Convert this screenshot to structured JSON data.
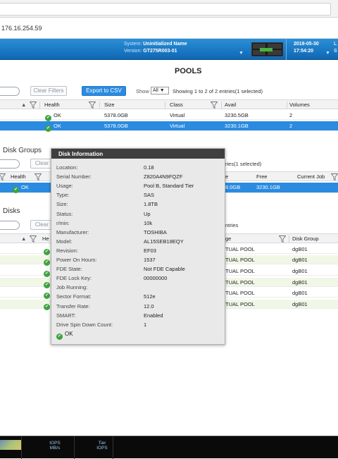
{
  "browser": {
    "url": "176.16.254.59"
  },
  "header": {
    "system_label": "System:",
    "system_name": "Uninitialized Name",
    "version_label": "Version:",
    "version_value": "GT275R003-01",
    "date": "2019-05-30",
    "time": "17:54:20",
    "edge_top": "L",
    "edge_bottom": "S"
  },
  "pools": {
    "title": "POOLS",
    "filter_button": "Clear Filters",
    "export_button": "Export to CSV",
    "show_label": "Show",
    "show_value": "All",
    "summary": "Showing 1 to 2 of 2 entries(1 selected)",
    "columns": [
      "Health",
      "Size",
      "Class",
      "Avail",
      "Volumes"
    ],
    "rows": [
      {
        "health": "OK",
        "size": "5378.0GB",
        "class": "Virtual",
        "avail": "3230.5GB",
        "volumes": "2"
      },
      {
        "health": "OK",
        "size": "5378.0GB",
        "class": "Virtual",
        "avail": "3230.1GB",
        "volumes": "2"
      }
    ]
  },
  "disk_groups": {
    "title": "Disk Groups",
    "filter_button": "Clear F",
    "summary": "ries(1 selected)",
    "columns": [
      "Health",
      "e",
      "Free",
      "Current Job"
    ],
    "row": {
      "health": "OK",
      "partial": "8.0GB",
      "free": "3230.1GB"
    }
  },
  "disks": {
    "title": "Disks",
    "filter_button": "Clear F",
    "summary": "ntries",
    "columns": [
      "He",
      "ge",
      "Disk Group"
    ],
    "rows": [
      {
        "usage": "TUAL POOL",
        "group": "dgB01"
      },
      {
        "usage": "TUAL POOL",
        "group": "dgB01"
      },
      {
        "usage": "TUAL POOL",
        "group": "dgB01"
      },
      {
        "usage": "TUAL POOL",
        "group": "dgB01"
      },
      {
        "usage": "TUAL POOL",
        "group": "dgB01"
      },
      {
        "usage": "TUAL POOL",
        "group": "dgB01"
      }
    ]
  },
  "popup": {
    "title": "Disk Information",
    "fields": [
      {
        "label": "Location:",
        "value": "0.18"
      },
      {
        "label": "Serial Number:",
        "value": "Z820A4N9FQZF"
      },
      {
        "label": "Usage:",
        "value": "Pool B, Standard Tier"
      },
      {
        "label": "Type:",
        "value": "SAS"
      },
      {
        "label": "Size:",
        "value": "1.8TB"
      },
      {
        "label": "Status:",
        "value": "Up"
      },
      {
        "label": "r/min:",
        "value": "10k"
      },
      {
        "label": "Manufacturer:",
        "value": "TOSHIBA"
      },
      {
        "label": "Model:",
        "value": "AL15SEB18EQY"
      },
      {
        "label": "Revision:",
        "value": "EF03"
      },
      {
        "label": "Power On Hours:",
        "value": "1537"
      },
      {
        "label": "FDE State:",
        "value": "Not FDE Capable"
      },
      {
        "label": "FDE Lock Key:",
        "value": "00000000"
      },
      {
        "label": "Job Running:",
        "value": ""
      },
      {
        "label": "Sector Format:",
        "value": "512e"
      },
      {
        "label": "Transfer Rate:",
        "value": "12.0"
      },
      {
        "label": "SMART:",
        "value": "Enabled"
      },
      {
        "label": "Drive Spin Down Count:",
        "value": "1"
      }
    ],
    "status": "OK"
  },
  "footer": {
    "iops_line1": "IOPS",
    "iops_line2": "MB/s",
    "tier_line1": "Tier",
    "tier_line2": "IOPS"
  },
  "colors": {
    "accent": "#2b8be0",
    "ok": "#3fa33f",
    "header": "#1a78c4"
  }
}
